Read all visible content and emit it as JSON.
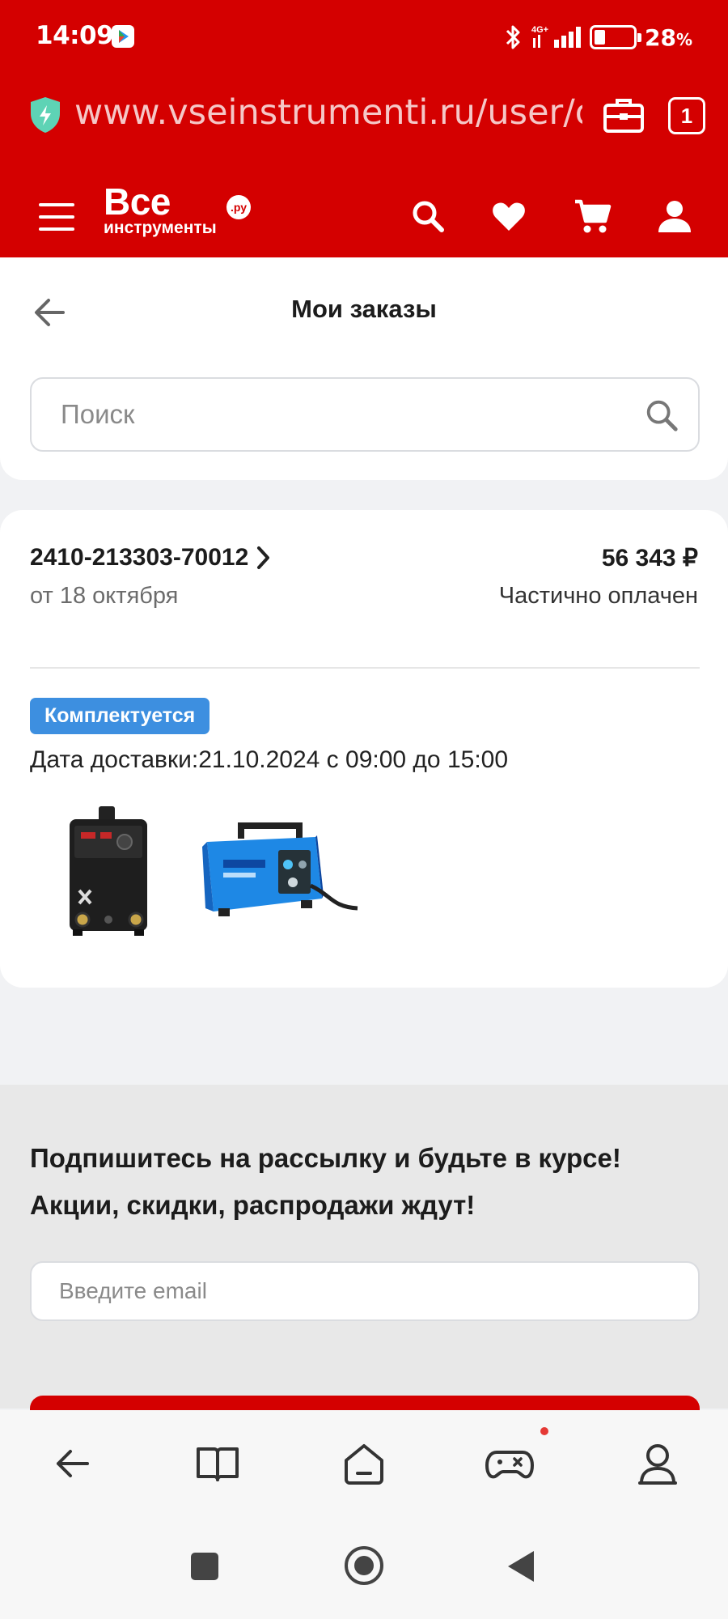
{
  "status_bar": {
    "time": "14:09",
    "battery_percent": "28",
    "battery_percent_sign": "%",
    "battery_level": 0.28,
    "network": "4G+"
  },
  "browser": {
    "url": "www.vseinstrumenti.ru/user/orders",
    "tab_count": "1",
    "icons": [
      "shield-icon",
      "briefcase-icon",
      "tabs-icon"
    ]
  },
  "site_header": {
    "logo_big": "Все",
    "logo_small": "инструменты",
    "logo_badge": ".ру",
    "icons": [
      "menu-icon",
      "search-icon",
      "heart-icon",
      "cart-icon",
      "user-icon"
    ]
  },
  "page": {
    "title": "Мои заказы",
    "search_placeholder": "Поиск"
  },
  "order": {
    "number": "2410-213303-70012",
    "date": "от 18 октября",
    "total": "56 343 ₽",
    "payment_status": "Частично оплачен",
    "badge": "Комплектуется",
    "delivery": "Дата доставки:21.10.2024 с 09:00 до 15:00"
  },
  "newsletter": {
    "title_line1": "Подпишитесь на рассылку и будьте в курсе!",
    "title_line2": "Акции, скидки, распродажи ждут!",
    "email_placeholder": "Введите email"
  },
  "bottom_nav": {
    "icons": [
      "back-icon",
      "book-icon",
      "home-icon",
      "gamepad-icon",
      "profile-icon"
    ]
  },
  "colors": {
    "brand_red": "#d40000",
    "badge_blue": "#3d8fe0"
  }
}
